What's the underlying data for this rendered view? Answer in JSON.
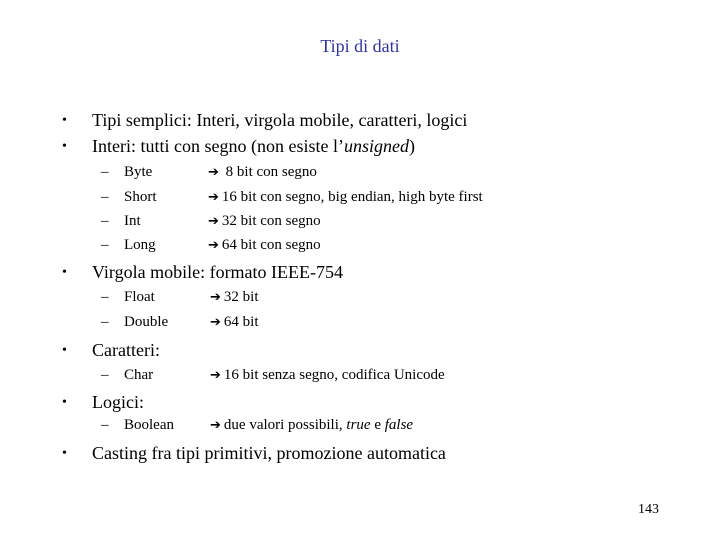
{
  "slide": {
    "title": "Tipi di dati",
    "page_number": "143",
    "bullets": {
      "b1": "Tipi semplici: Interi, virgola mobile, caratteri, logici",
      "b2_pre": "Interi: tutti con segno (non esiste l’",
      "b2_italic": "unsigned",
      "b2_post": ")",
      "b3": "Virgola mobile: formato IEEE-754",
      "b4": "Caratteri:",
      "b5": "Logici:",
      "b6": "Casting fra tipi primitivi, promozione automatica"
    },
    "bullet_symbol": "•",
    "dash_symbol": "–",
    "arrow_symbol": "➔",
    "integers": [
      {
        "type": "Byte",
        "desc": " 8 bit con segno"
      },
      {
        "type": "Short",
        "desc": "16 bit con segno, big endian, high byte first"
      },
      {
        "type": "Int",
        "desc": "32 bit con segno"
      },
      {
        "type": "Long",
        "desc": "64 bit con segno"
      }
    ],
    "floats": [
      {
        "type": "Float",
        "desc": "32 bit"
      },
      {
        "type": "Double",
        "desc": "64 bit"
      }
    ],
    "chars": [
      {
        "type": "Char",
        "desc": "16 bit senza segno, codifica Unicode"
      }
    ],
    "booleans": {
      "type": "Boolean",
      "desc_pre": "due valori possibili, ",
      "true_word": "true",
      "mid": " e ",
      "false_word": "false"
    },
    "colors": {
      "title": "#333399",
      "text": "#000000"
    }
  }
}
